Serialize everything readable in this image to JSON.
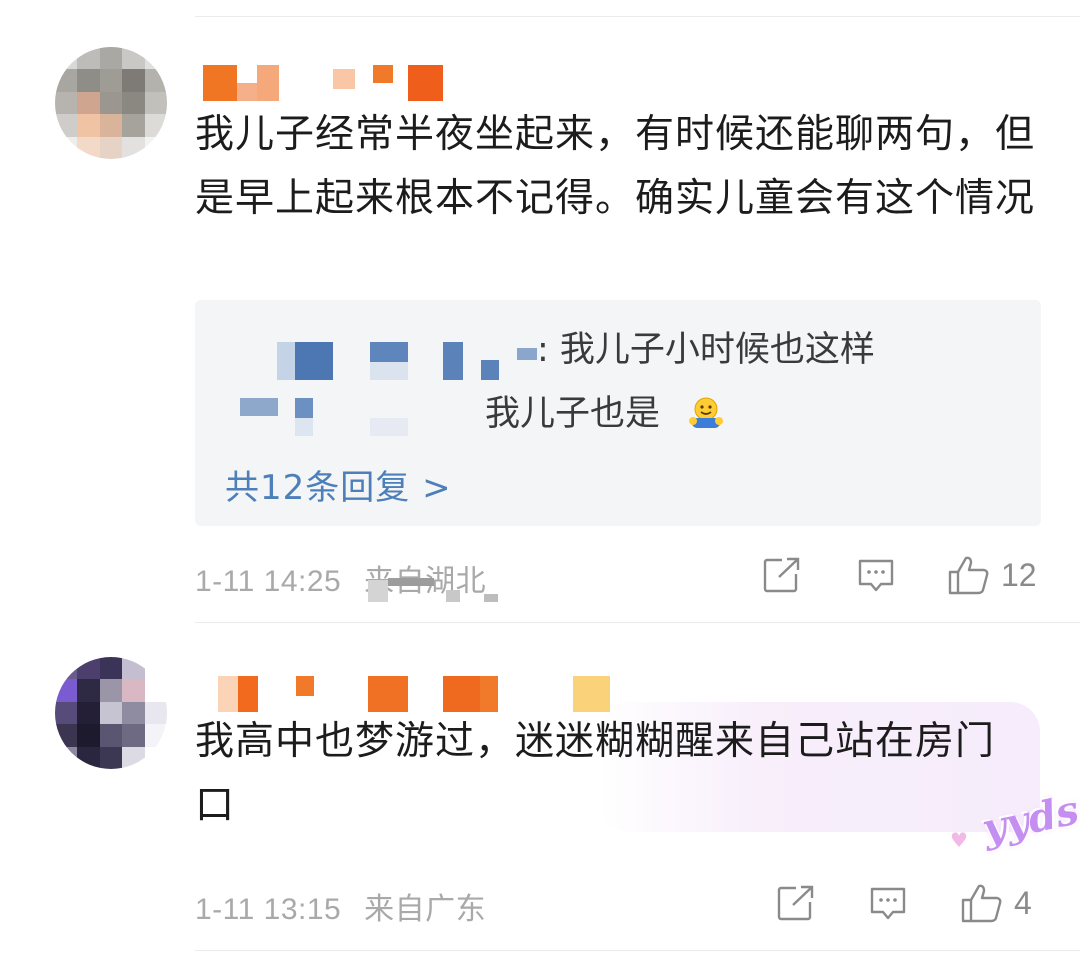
{
  "colors": {
    "link": "#4d7fb8",
    "meta": "#a9a9a9",
    "name_orange": "#f06a1d"
  },
  "comments": [
    {
      "text": "我儿子经常半夜坐起来，有时候还能聊两句，但是早上起来根本不记得。确实儿童会有这个情况",
      "replies": [
        {
          "text": ": 我儿子小时候也这样"
        },
        {
          "text": "我儿子也是"
        }
      ],
      "reply_emoji": "hug-emoji",
      "more_replies": "共12条回复 >",
      "time": "1-11 14:25",
      "location": "来自湖北",
      "like_count": "12"
    },
    {
      "text": "我高中也梦游过，迷迷糊糊醒来自己站在房门口",
      "sticker": "yyds",
      "time": "1-11 13:15",
      "location": "来自广东",
      "like_count": "4"
    }
  ],
  "icons": [
    "share-icon",
    "comment-icon",
    "like-icon"
  ]
}
